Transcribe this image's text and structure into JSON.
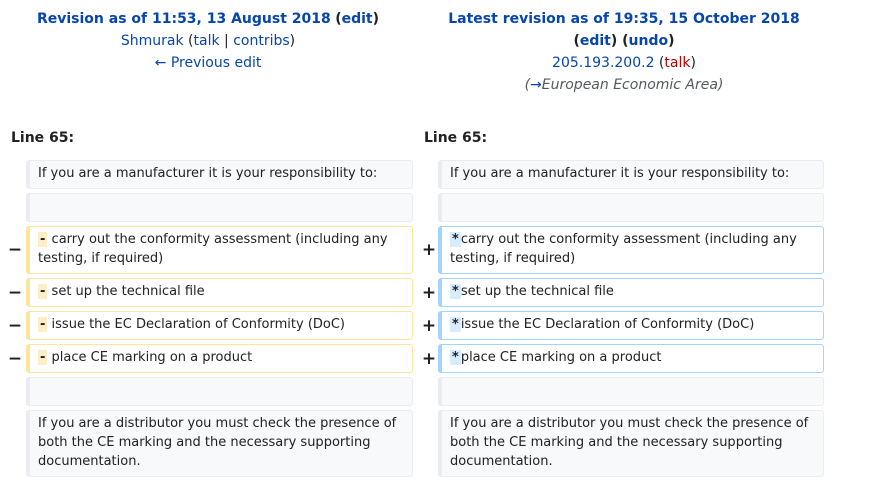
{
  "left_header": {
    "revision_title": "Revision as of 11:53, 13 August 2018",
    "edit": "edit",
    "user": "Shmurak",
    "talk": "talk",
    "contribs": "contribs",
    "previous_edit": "← Previous edit"
  },
  "right_header": {
    "revision_title": "Latest revision as of 19:35, 15 October 2018",
    "edit": "edit",
    "undo": "undo",
    "ip": "205.193.200.2",
    "talk": "talk",
    "summary_arrow": "→",
    "summary_section": "European Economic Area"
  },
  "line_label": "Line 65:",
  "diff": {
    "intro": "If you are a manufacturer it is your responsibility to:",
    "old_marker": "-",
    "new_marker": "*",
    "removed_sign": "−",
    "added_sign": "+",
    "items": [
      "carry out the conformity assessment (including any testing, if required)",
      "set up the technical file",
      "issue the EC Declaration of Conformity (DoC)",
      "place CE marking on a product"
    ],
    "outro": "If you are a distributor you must check the presence of both the CE marking and the necessary supporting documentation."
  }
}
